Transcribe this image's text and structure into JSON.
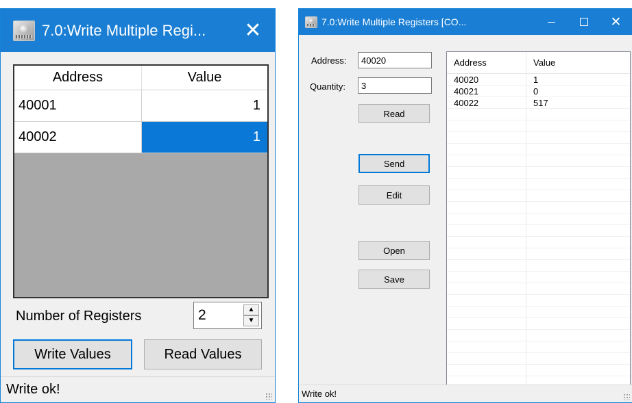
{
  "window1": {
    "title": "7.0:Write Multiple Regi...",
    "close_glyph": "✕",
    "grid": {
      "headers": [
        "Address",
        "Value"
      ],
      "rows": [
        {
          "address": "40001",
          "value": "1"
        },
        {
          "address": "40002",
          "value": "1"
        }
      ]
    },
    "num_registers_label": "Number of Registers",
    "num_registers_value": "2",
    "write_button": "Write Values",
    "read_button": "Read Values",
    "status": "Write ok!"
  },
  "window2": {
    "title": "7.0:Write Multiple Registers [CO...",
    "close_glyph": "✕",
    "address_label": "Address:",
    "address_value": "40020",
    "quantity_label": "Quantity:",
    "quantity_value": "3",
    "read_button": "Read",
    "send_button": "Send",
    "edit_button": "Edit",
    "open_button": "Open",
    "save_button": "Save",
    "grid": {
      "headers": [
        "Address",
        "Value"
      ],
      "rows": [
        {
          "address": "40020",
          "value": "1"
        },
        {
          "address": "40021",
          "value": "0"
        },
        {
          "address": "40022",
          "value": "517"
        }
      ]
    },
    "status": "Write ok!"
  },
  "colors": {
    "titlebar": "#1a7fd4",
    "selection": "#0a78d7",
    "focus_border": "#0078d7",
    "empty_grid": "#a9a9a9"
  },
  "icons": [
    "app-icon",
    "close-icon",
    "minimize-icon",
    "maximize-icon",
    "spin-up-icon",
    "spin-down-icon",
    "resize-grip-icon"
  ]
}
